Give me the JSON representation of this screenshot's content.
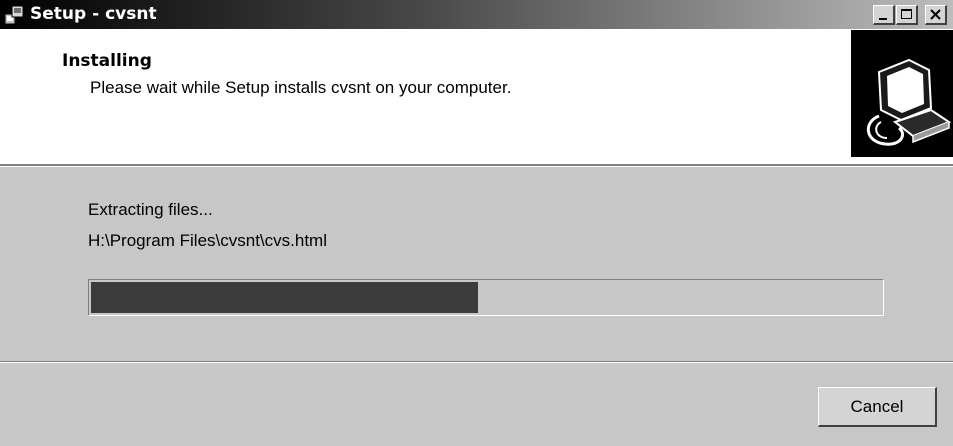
{
  "window": {
    "title": "Setup - cvsnt",
    "controls": [
      "minimize",
      "maximize",
      "close"
    ]
  },
  "header": {
    "title": "Installing",
    "subtitle": "Please wait while Setup installs cvsnt on your computer."
  },
  "progress": {
    "status": "Extracting files...",
    "current_file": "H:\\Program Files\\cvsnt\\cvs.html",
    "fraction": 0.49
  },
  "buttons": {
    "cancel_label": "Cancel"
  },
  "icons": {
    "app": "setup-app-icon",
    "wizard": "installer-computer-icon"
  },
  "colors": {
    "title_gradient_start": "#000000",
    "title_gradient_end": "#bdbdbd",
    "progress_fill": "#3b3b3b"
  }
}
